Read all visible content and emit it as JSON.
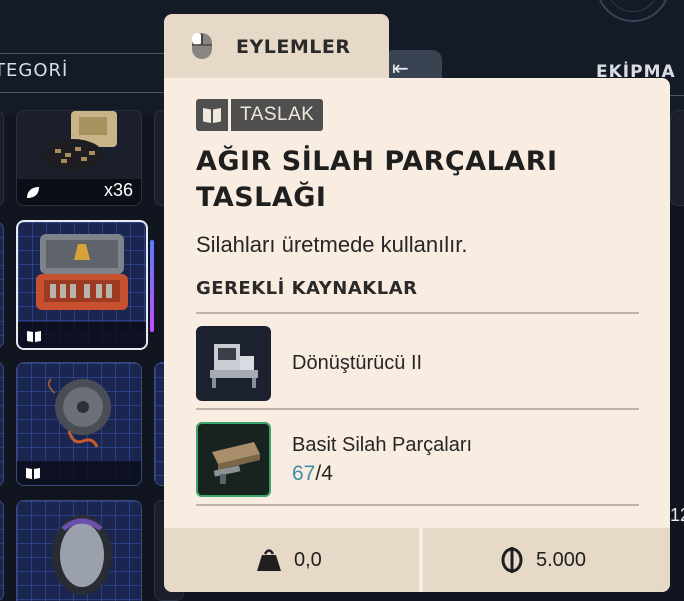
{
  "background": {
    "category_label": "TEGORİ",
    "equipment_label": "EKİPMA",
    "edge_count": "12",
    "slots": [
      {
        "count": "x36"
      }
    ]
  },
  "actions": {
    "label": "EYLEMLER"
  },
  "item": {
    "tag": "TASLAK",
    "title": "AĞIR SİLAH PARÇALARI TASLAĞI",
    "description": "Silahları üretmede kullanılır.",
    "requirements_heading": "GEREKLİ KAYNAKLAR",
    "resources": [
      {
        "name": "Dönüştürücü II",
        "icon": "workbench-icon"
      },
      {
        "name": "Basit Silah Parçaları",
        "have": "67",
        "separator": "/",
        "need": "4",
        "icon": "weapon-parts-icon"
      }
    ],
    "weight": "0,0",
    "price": "5.000"
  },
  "colors": {
    "card_bg": "#f8ede0",
    "tab_bg": "#e6d9c7",
    "tag_bg": "#4f4f4f",
    "have_count": "#3f8fa6",
    "resource_border": "#3aa36a"
  }
}
